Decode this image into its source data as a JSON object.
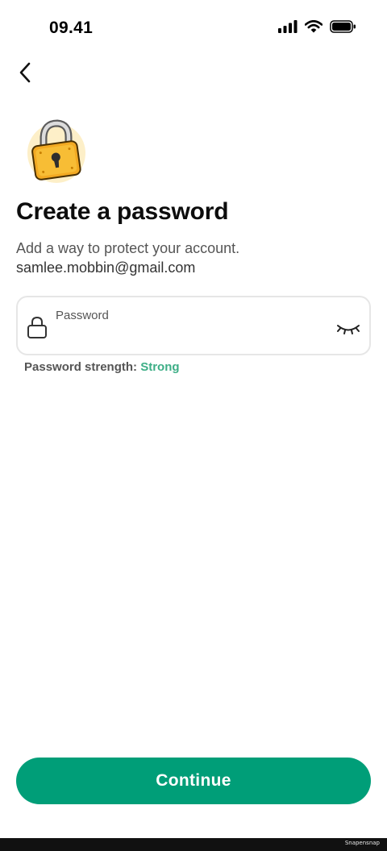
{
  "status_bar": {
    "time": "09.41",
    "icons": [
      "cellular-signal-icon",
      "wifi-icon",
      "battery-icon"
    ]
  },
  "nav": {
    "back_icon": "chevron-left-icon"
  },
  "illustration": "padlock-illustration",
  "header": {
    "title": "Create a password",
    "subtitle": "Add a way to protect your account.",
    "email": "samlee.mobbin@gmail.com"
  },
  "password_field": {
    "label": "Password",
    "value": "",
    "leading_icon": "lock-icon",
    "toggle_icon": "eye-closed-icon"
  },
  "strength": {
    "label": "Password strength: ",
    "value": "Strong"
  },
  "continue_button": {
    "label": "Continue"
  },
  "watermark": "Snapensnap",
  "colors": {
    "primary": "#009e78",
    "strength_strong": "#3dae86",
    "field_border": "#e6e6e6",
    "lock_gold": "#f2a922"
  }
}
